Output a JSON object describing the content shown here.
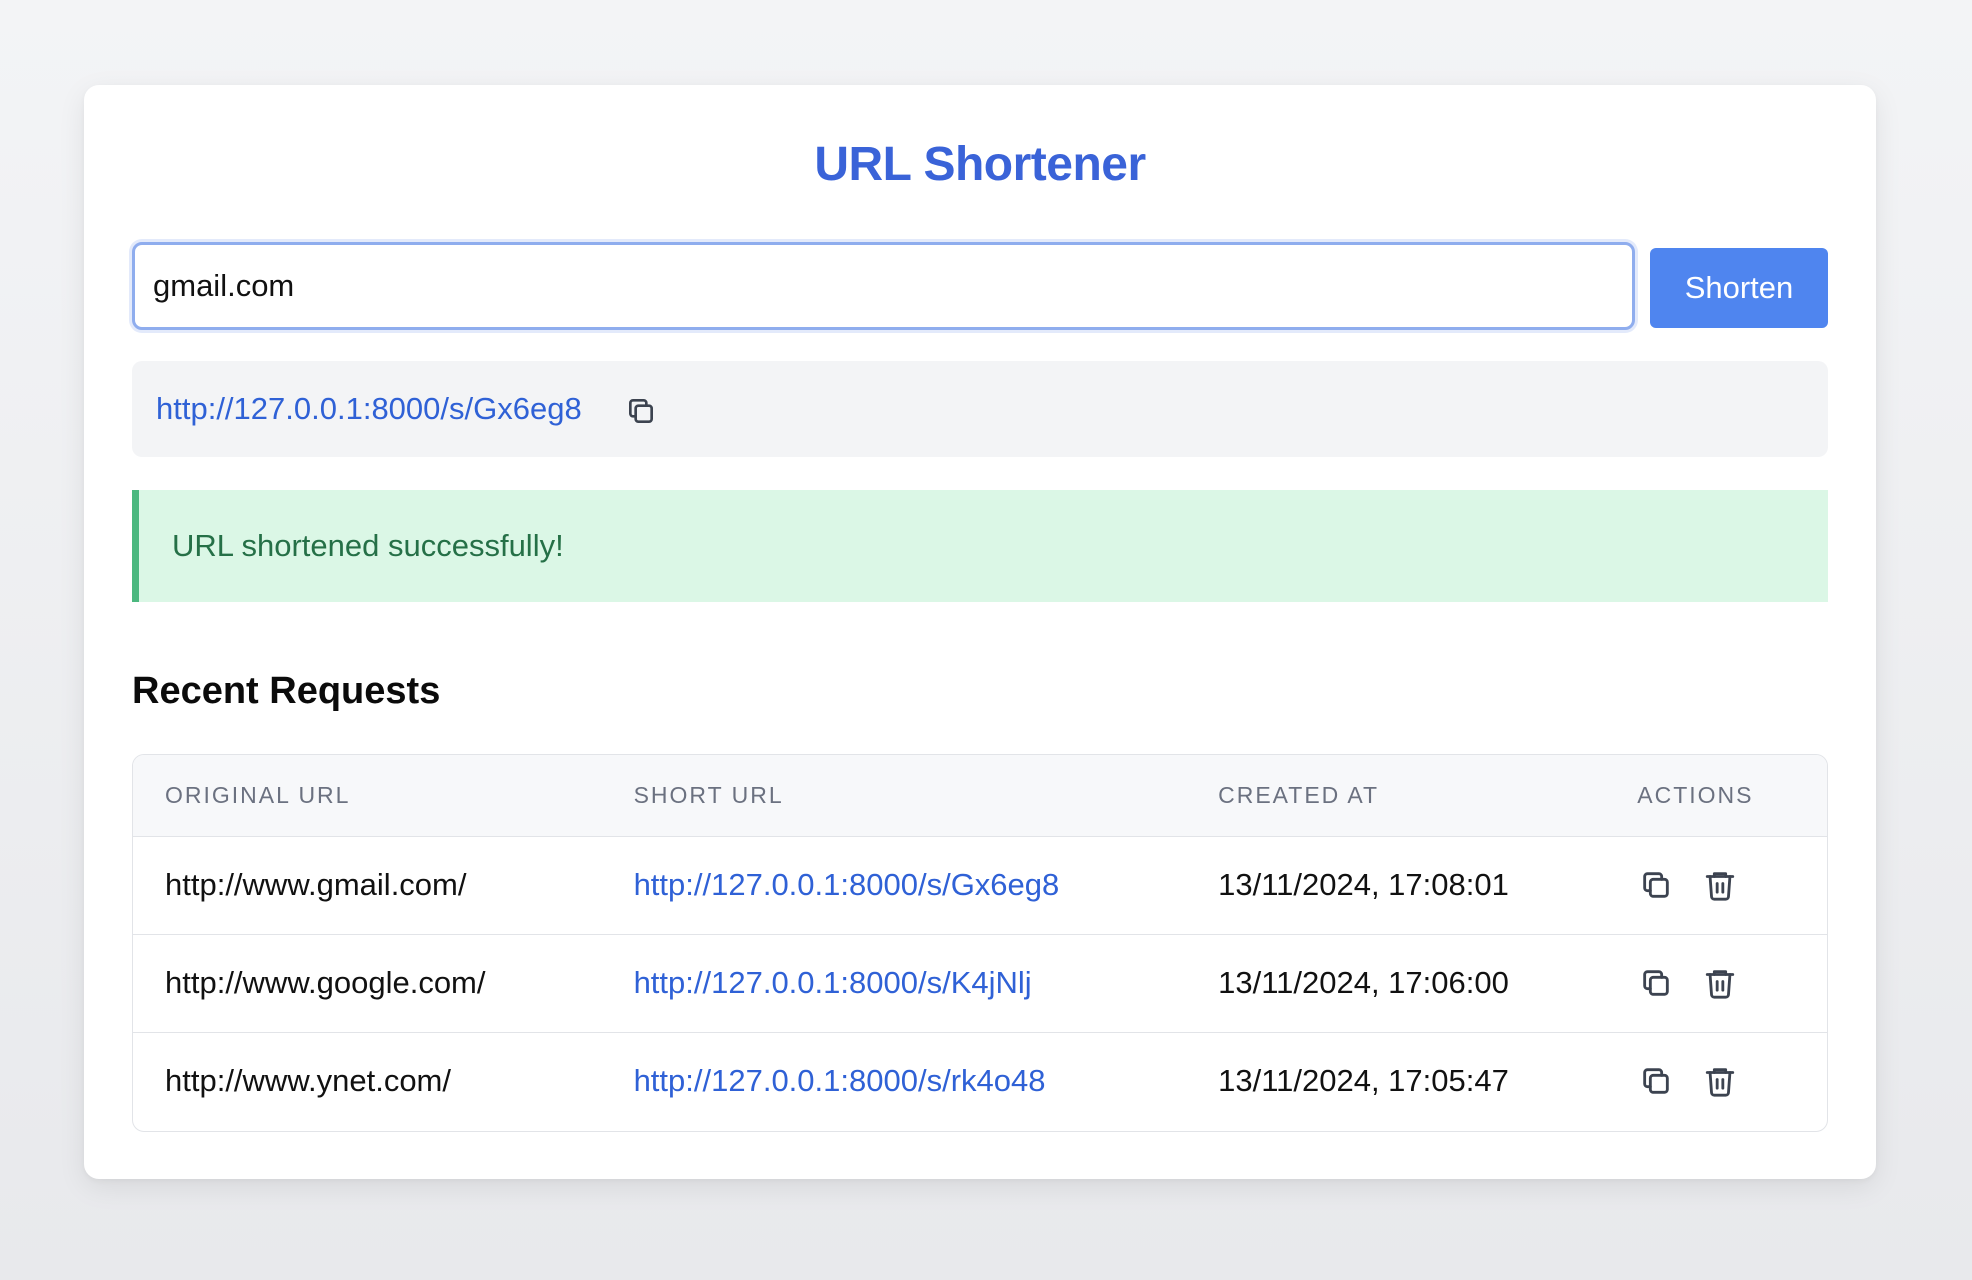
{
  "app": {
    "title": "URL Shortener"
  },
  "form": {
    "url_value": "gmail.com",
    "submit_label": "Shorten"
  },
  "result": {
    "short_url": "http://127.0.0.1:8000/s/Gx6eg8",
    "copy_icon": "copy-icon"
  },
  "alert": {
    "message": "URL shortened successfully!",
    "status": "success",
    "color": "#dbf7e6",
    "border_color": "#4bb87f"
  },
  "recent": {
    "title": "Recent Requests",
    "columns": [
      "ORIGINAL URL",
      "SHORT URL",
      "CREATED AT",
      "ACTIONS"
    ],
    "rows": [
      {
        "original_url": "http://www.gmail.com/",
        "short_url": "http://127.0.0.1:8000/s/Gx6eg8",
        "created_at": "13/11/2024, 17:08:01",
        "actions": [
          "copy-icon",
          "trash-icon"
        ]
      },
      {
        "original_url": "http://www.google.com/",
        "short_url": "http://127.0.0.1:8000/s/K4jNlj",
        "created_at": "13/11/2024, 17:06:00",
        "actions": [
          "copy-icon",
          "trash-icon"
        ]
      },
      {
        "original_url": "http://www.ynet.com/",
        "short_url": "http://127.0.0.1:8000/s/rk4o48",
        "created_at": "13/11/2024, 17:05:47",
        "actions": [
          "copy-icon",
          "trash-icon"
        ]
      }
    ]
  },
  "colors": {
    "accent": "#3a63d8",
    "button": "#4f85ef",
    "link": "#2f61d6"
  }
}
